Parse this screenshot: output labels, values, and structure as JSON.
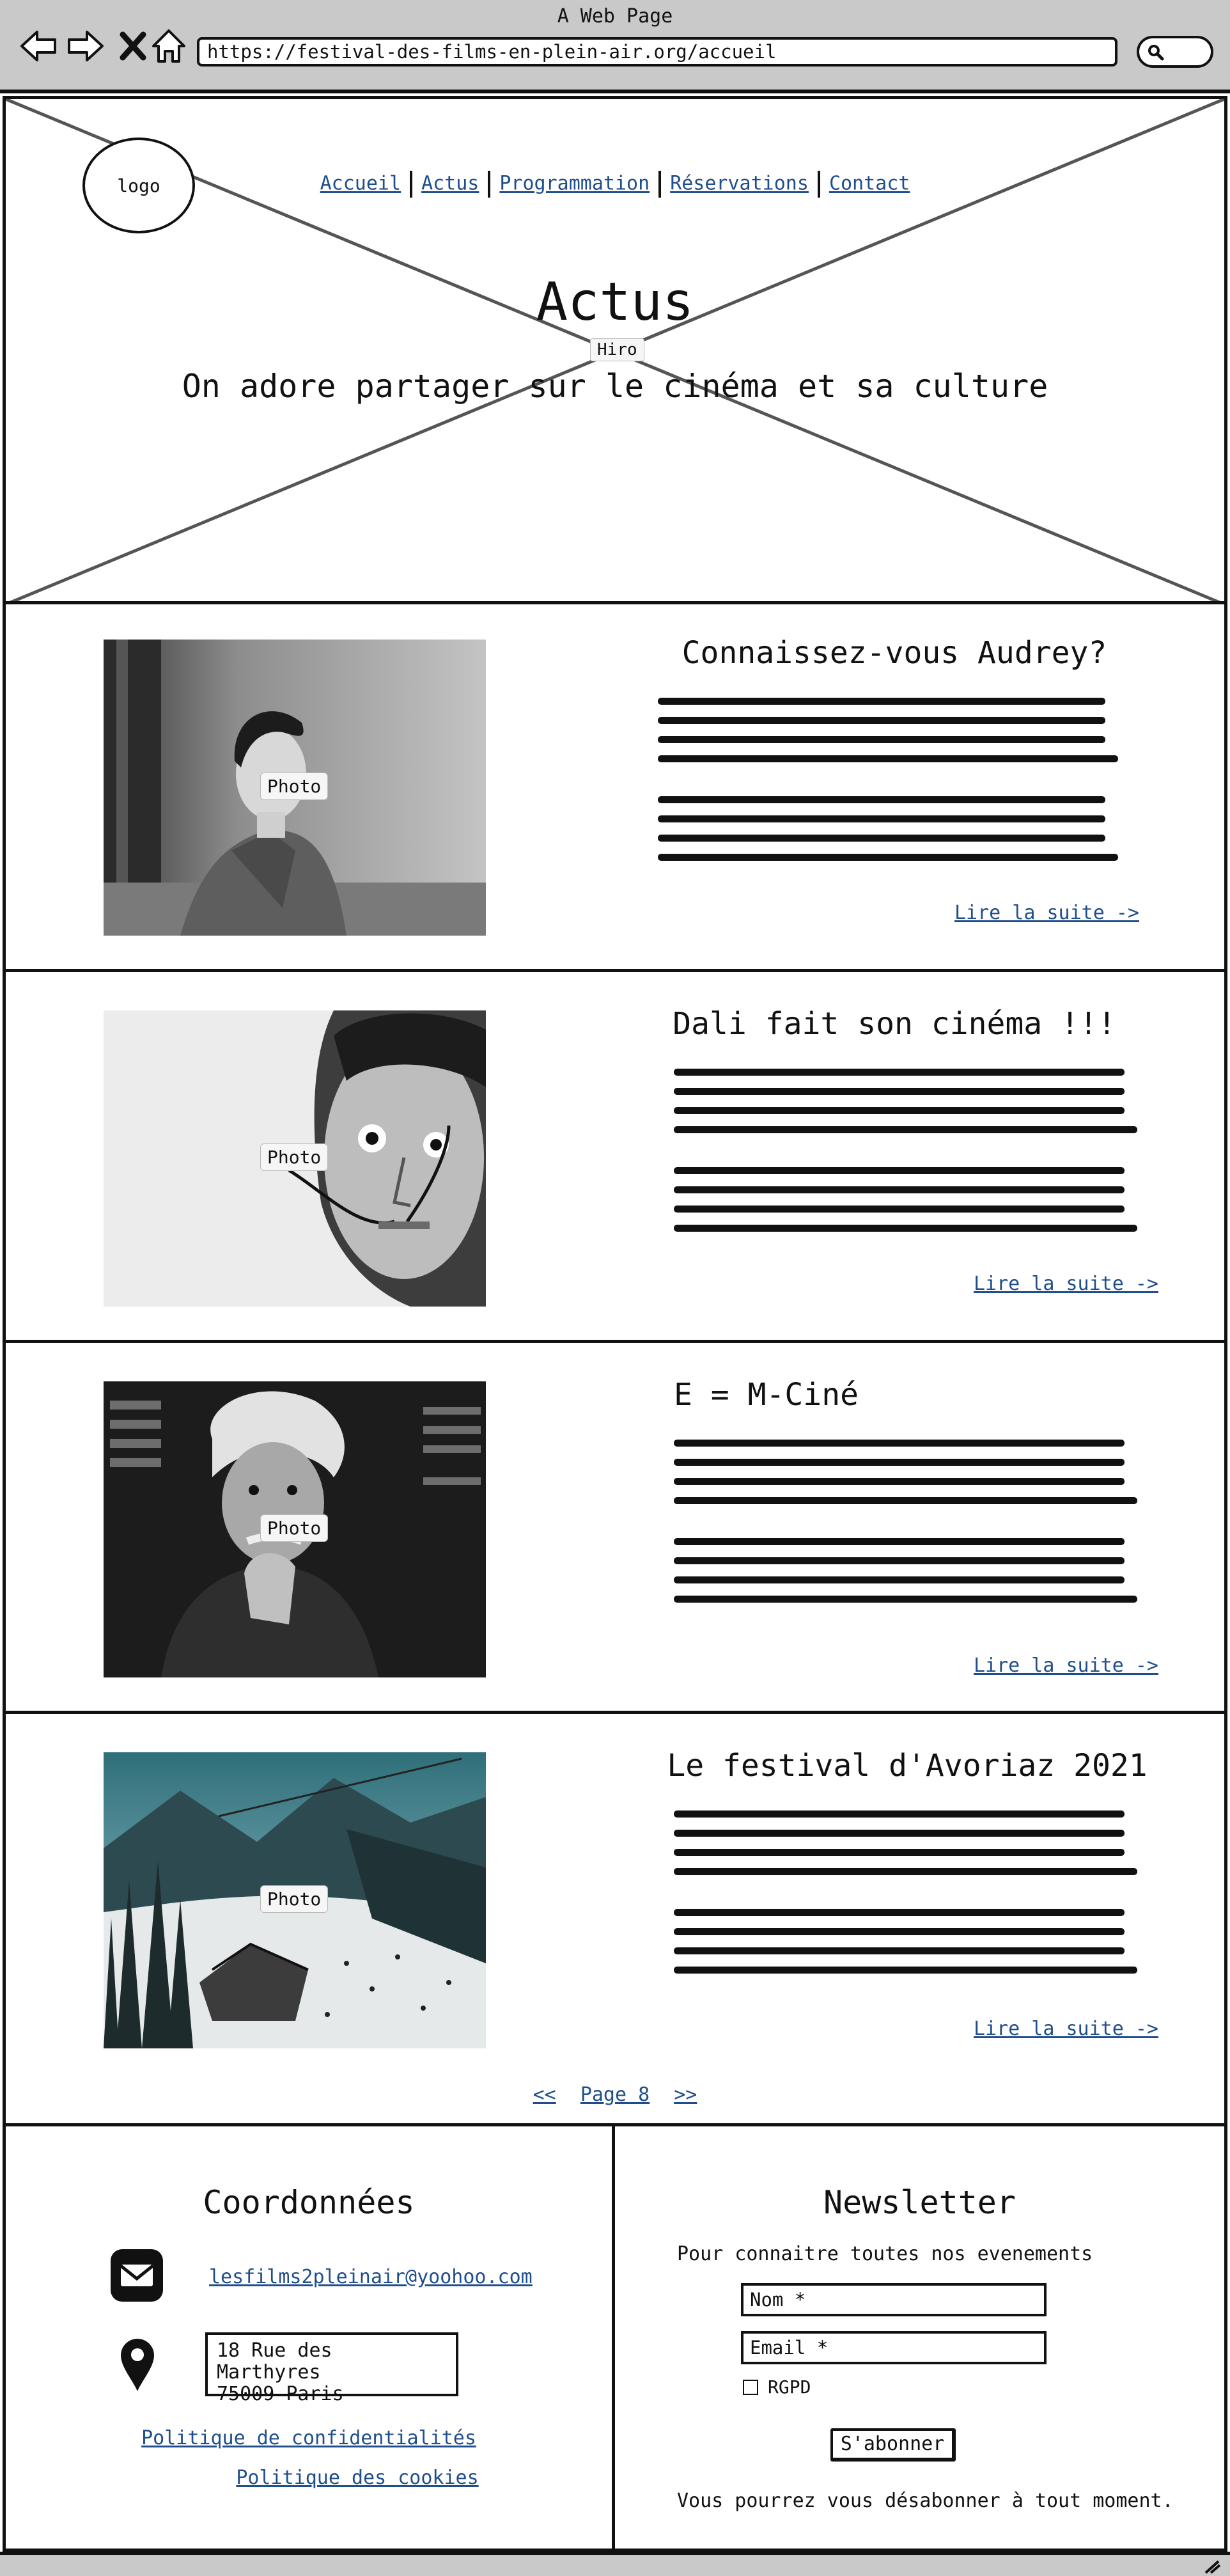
{
  "window": {
    "title": "A Web Page"
  },
  "browser": {
    "url": "https://festival-des-films-en-plein-air.org/accueil"
  },
  "header": {
    "logo_text": "logo",
    "nav": [
      "Accueil",
      "Actus",
      "Programmation",
      "Réservations",
      "Contact"
    ],
    "title": "Actus",
    "subtitle": "On adore partager sur le cinéma et sa culture",
    "hero_tag": "Hiro"
  },
  "articles": [
    {
      "title": "Connaissez-vous Audrey?",
      "photo_tag": "Photo",
      "read_more": "Lire la suite ->"
    },
    {
      "title": "Dali fait son cinéma !!!",
      "photo_tag": "Photo",
      "read_more": "Lire la suite ->"
    },
    {
      "title": "E = M-Ciné",
      "photo_tag": "Photo",
      "read_more": "Lire la suite ->"
    },
    {
      "title": "Le festival d'Avoriaz 2021",
      "photo_tag": "Photo",
      "read_more": "Lire la suite ->"
    }
  ],
  "pagination": {
    "prev": "<<",
    "label": "Page 8",
    "next": ">>"
  },
  "footer": {
    "contact": {
      "title": "Coordonnées",
      "email": "lesfilms2pleinair@yoohoo.com",
      "address_line1": "18 Rue des Marthyres",
      "address_line2": "75009 Paris",
      "privacy": "Politique de confidentialités",
      "cookies": "Politique des cookies"
    },
    "newsletter": {
      "title": "Newsletter",
      "description": "Pour connaitre toutes nos evenements",
      "name_placeholder": "Nom *",
      "email_placeholder": "Email *",
      "rgpd_label": "RGPD",
      "subscribe": "S'abonner",
      "note": "Vous pourrez vous désabonner à tout moment."
    }
  },
  "icons": {
    "back": "arrow-left-icon",
    "forward": "arrow-right-icon",
    "stop": "close-icon",
    "home": "home-icon",
    "search": "search-icon",
    "mail": "mail-icon",
    "location": "map-pin-icon"
  },
  "colors": {
    "link": "#1f4e8c",
    "chrome": "#c9c9c9",
    "stroke": "#111111"
  }
}
